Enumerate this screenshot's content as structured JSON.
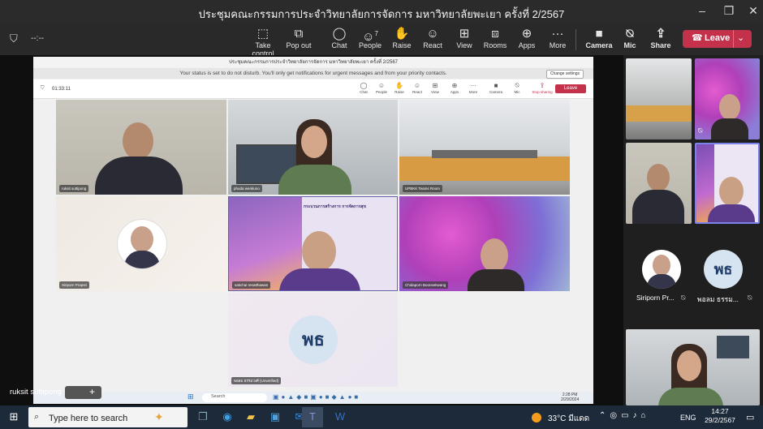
{
  "window": {
    "title": "ประชุมคณะกรรมการประจำวิทยาลัยการจัดการ มหาวิทยาลัยพะเยา ครั้งที่ 2/2567",
    "min": "–",
    "max": "❐",
    "close": "✕"
  },
  "toolbar": {
    "timer": "--:--",
    "take_control": "Take control",
    "pop_out": "Pop out",
    "chat": "Chat",
    "people": "People",
    "people_count": "7",
    "raise": "Raise",
    "react": "React",
    "view": "View",
    "rooms": "Rooms",
    "apps": "Apps",
    "more": "More",
    "camera": "Camera",
    "mic": "Mic",
    "share": "Share",
    "leave": "Leave"
  },
  "shared": {
    "title": "ประชุมคณะกรรมการประจำวิทยาลัยการจัดการ มหาวิทยาลัยพะเยา ครั้งที่ 2/2567",
    "banner": "Your status is set to do not disturb. You'll only get notifications for urgent messages and from your priority contacts.",
    "change_settings": "Change settings",
    "timer": "01:33:11",
    "toolbar": [
      "Chat",
      "People",
      "Raise",
      "React",
      "View",
      "Apps",
      "More",
      "Camera",
      "Mic",
      "Stop sharing"
    ],
    "leave": "Leave",
    "tiles": [
      "ruksit suttipong",
      "phuda wenkuno",
      "UPBKK Teams Room",
      "Siriporn Prapsri",
      "sakchai renatthawan",
      "Chidaporn Boonsekwang",
      "พอลม ธรรมวงศ์ (Unverified)"
    ],
    "avatar_initials": "พธ",
    "slide_heading": "กระบวนการสร้างการ การจัดการสุข",
    "taskbar_search": "Search",
    "taskbar_time": "2:28 PM",
    "taskbar_date": "2/29/2024"
  },
  "strip": {
    "siriporn": "Siriporn Pr...",
    "ploam": "พอลม ธรรม...",
    "avatar_initials": "พธ"
  },
  "self_name": "ruksit suttipong",
  "taskbar": {
    "search_placeholder": "Type here to search",
    "weather": "33°C มีแดด",
    "lang": "ENG",
    "time": "14:27",
    "date": "29/2/2567"
  },
  "colors": {
    "leave": "#c4314b",
    "taskbar": "#1c2a3a",
    "accent": "#6264a7"
  }
}
